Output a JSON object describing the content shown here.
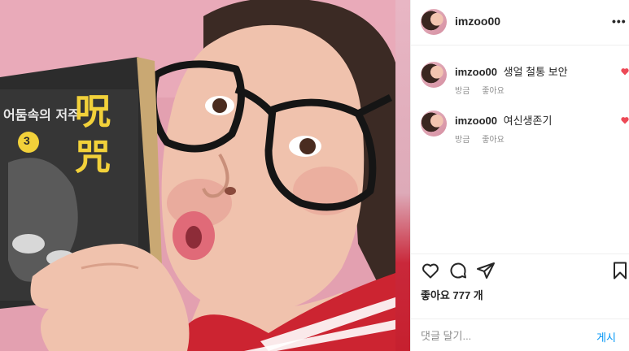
{
  "post": {
    "username": "imzoo00",
    "more_label": "•••"
  },
  "comments": [
    {
      "username": "imzoo00",
      "text": "생얼 철통 보안",
      "time": "방금",
      "like_label": "좋아요",
      "heart_color": "#ed4956"
    },
    {
      "username": "imzoo00",
      "text": "여신생존기",
      "time": "방금",
      "like_label": "좋아요",
      "heart_color": "#ed4956"
    }
  ],
  "actions": {
    "likes_text": "좋아요 777 개",
    "icons": [
      "heart-icon",
      "comment-icon",
      "share-icon",
      "bookmark-icon"
    ]
  },
  "composer": {
    "placeholder": "댓글 달기...",
    "post_label": "게시"
  },
  "photo": {
    "book_title": "어둠속의 저주",
    "book_volume": "3",
    "book_kanji": "呪咒"
  },
  "colors": {
    "accent": "#0095f6",
    "text": "#262626",
    "muted": "#8e8e8e",
    "heart": "#ed4956",
    "border": "#efefef"
  }
}
